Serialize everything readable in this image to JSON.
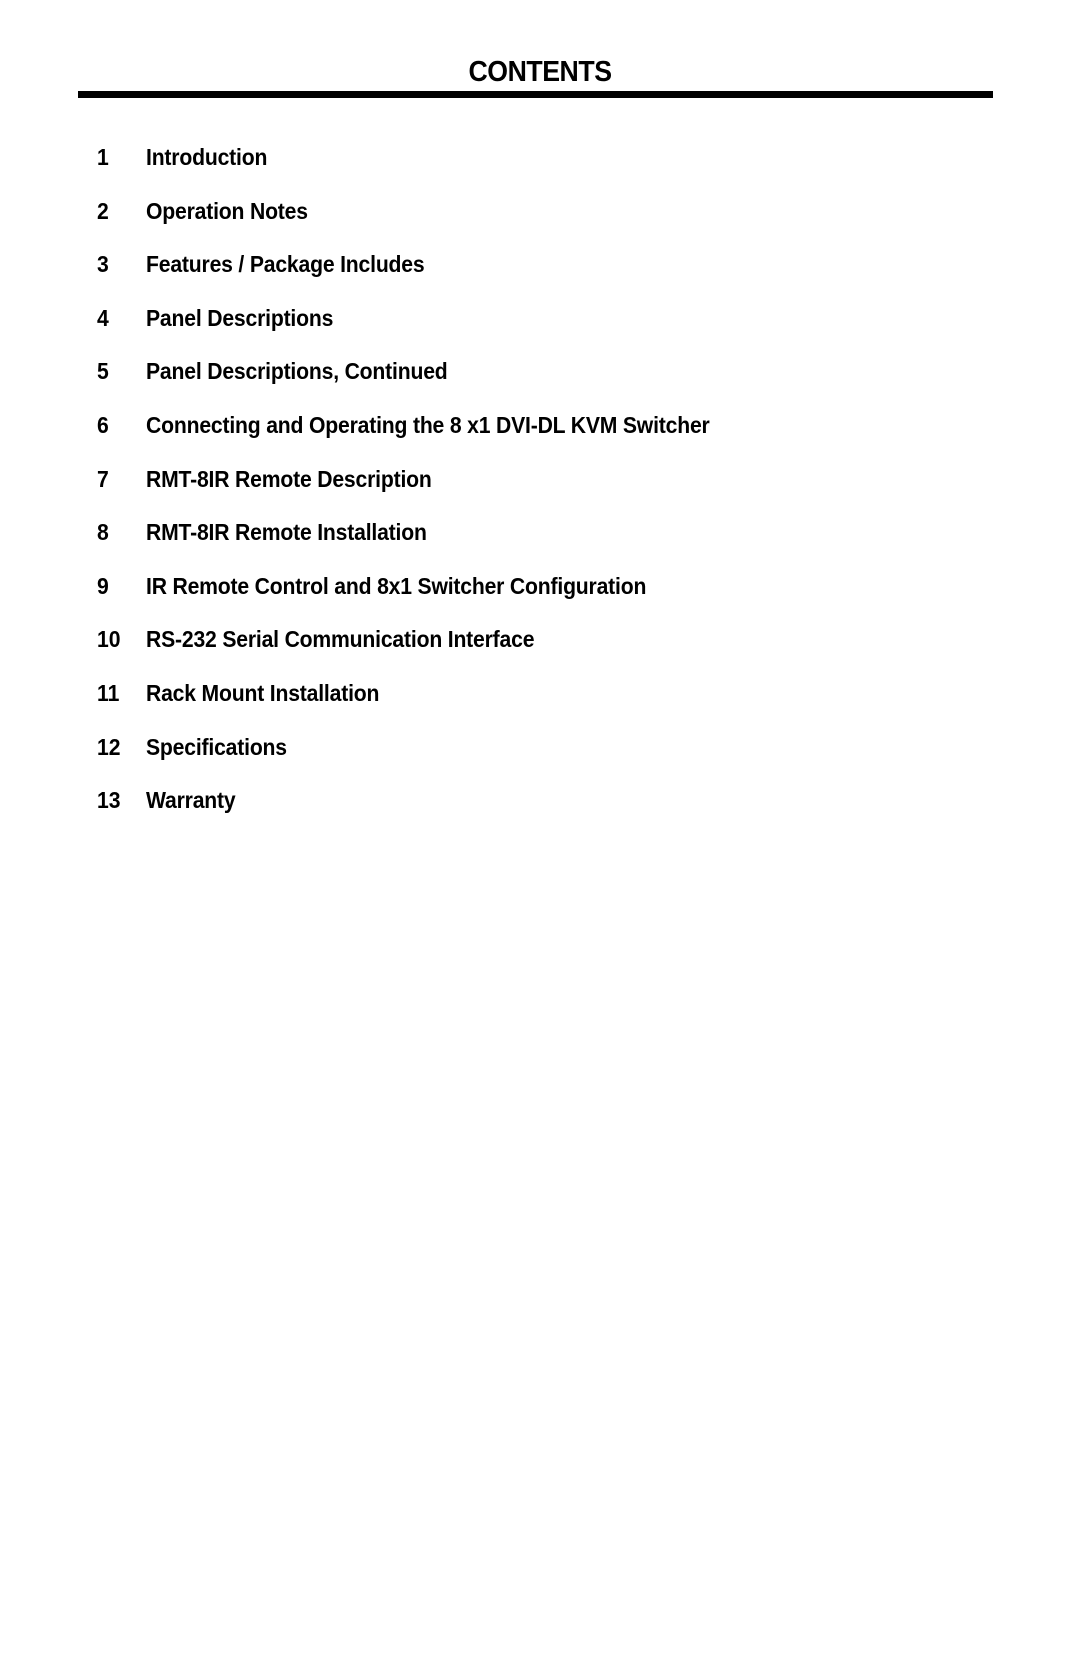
{
  "document": {
    "title": "CONTENTS",
    "toc": [
      {
        "number": "1",
        "label": "Introduction"
      },
      {
        "number": "2",
        "label": "Operation Notes"
      },
      {
        "number": "3",
        "label": "Features / Package Includes"
      },
      {
        "number": "4",
        "label": "Panel Descriptions"
      },
      {
        "number": "5",
        "label": "Panel Descriptions, Continued"
      },
      {
        "number": "6",
        "label": "Connecting and Operating the 8 x1 DVI-DL KVM Switcher"
      },
      {
        "number": "7",
        "label": "RMT-8IR Remote Description"
      },
      {
        "number": "8",
        "label": "RMT-8IR Remote Installation"
      },
      {
        "number": "9",
        "label": "IR Remote Control and 8x1 Switcher Configuration"
      },
      {
        "number": "10",
        "label": "RS-232 Serial Communication Interface"
      },
      {
        "number": "11",
        "label": "Rack Mount Installation"
      },
      {
        "number": "12",
        "label": "Specifications"
      },
      {
        "number": "13",
        "label": "Warranty"
      }
    ]
  }
}
